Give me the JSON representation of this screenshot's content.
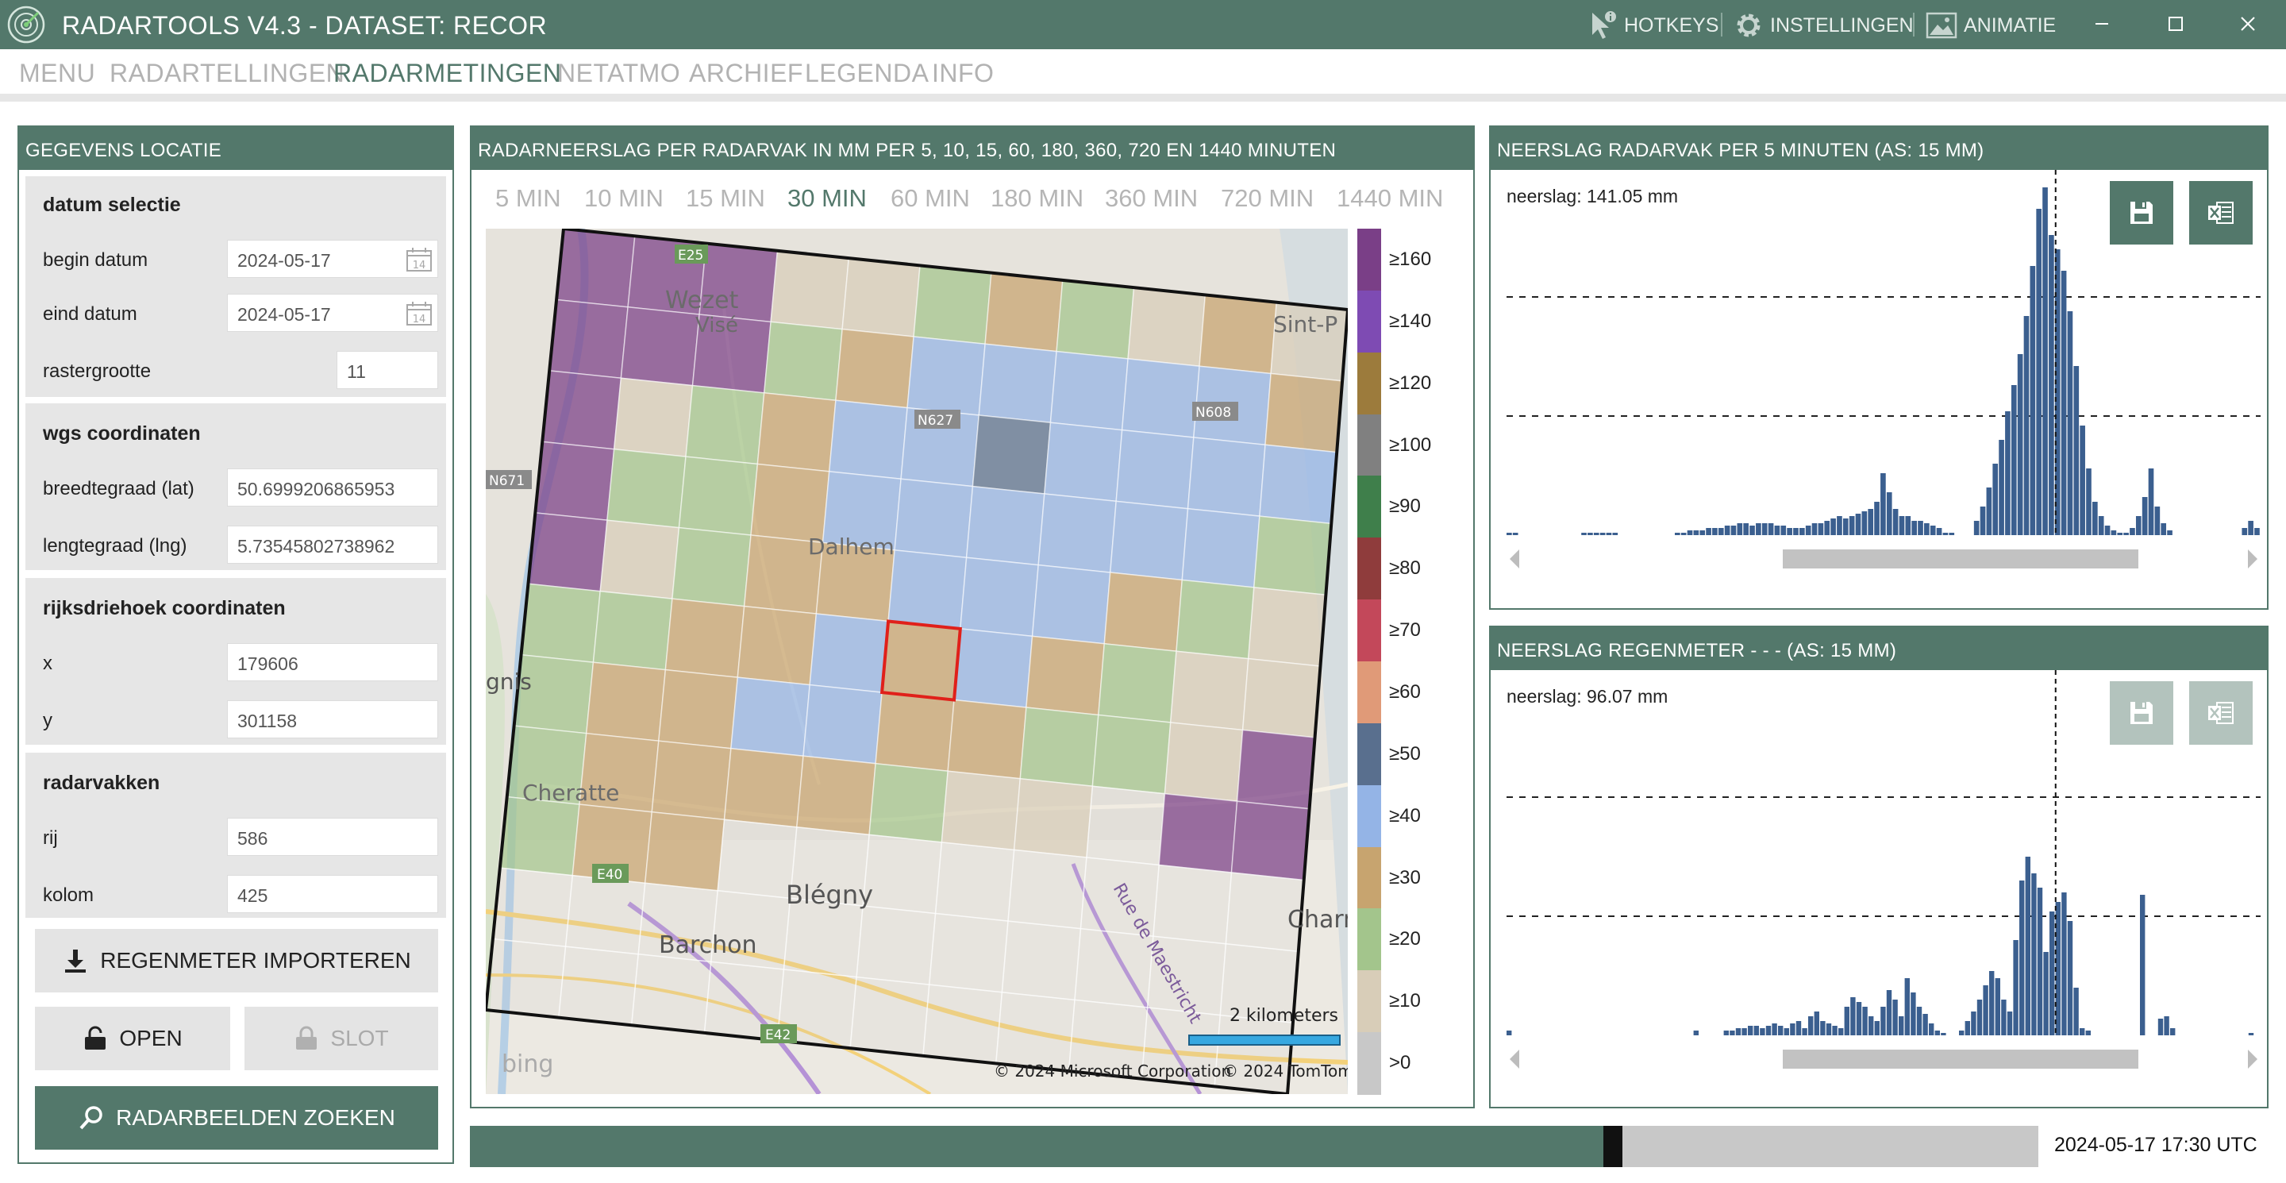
{
  "window": {
    "title": "RADARTOOLS V4.3 - DATASET: RECOR",
    "actions": {
      "hotkeys": "HOTKEYS",
      "settings": "INSTELLINGEN",
      "animation": "ANIMATIE"
    }
  },
  "menu": [
    "MENU",
    "RADARTELLINGEN",
    "RADARMETINGEN",
    "NETATMO",
    "ARCHIEF",
    "LEGENDA",
    "INFO"
  ],
  "menu_active": "RADARMETINGEN",
  "left_panel": {
    "title": "GEGEVENS LOCATIE",
    "date_selection": {
      "title": "datum selectie",
      "begin_label": "begin datum",
      "begin_value": "2024-05-17",
      "end_label": "eind datum",
      "end_value": "2024-05-17",
      "grid_label": "rastergrootte",
      "grid_value": "11"
    },
    "wgs": {
      "title": "wgs coordinaten",
      "lat_label": "breedtegraad (lat)",
      "lat_value": "50.6999206865953",
      "lng_label": "lengtegraad (lng)",
      "lng_value": "5.73545802738962"
    },
    "rd": {
      "title": "rijksdriehoek coordinaten",
      "x_label": "x",
      "x_value": "179606",
      "y_label": "y",
      "y_value": "301158"
    },
    "radar_cells": {
      "title": "radarvakken",
      "row_label": "rij",
      "row_value": "586",
      "col_label": "kolom",
      "col_value": "425"
    },
    "buttons": {
      "import": "REGENMETER IMPORTEREN",
      "open": "OPEN",
      "lock": "SLOT",
      "search": "RADARBEELDEN ZOEKEN"
    }
  },
  "map_panel": {
    "title": "RADARNEERSLAG PER RADARVAK IN MM PER 5, 10, 15, 60, 180, 360, 720 EN 1440 MINUTEN",
    "tabs": [
      "5 MIN",
      "10 MIN",
      "15 MIN",
      "30 MIN",
      "60 MIN",
      "180 MIN",
      "360 MIN",
      "720 MIN",
      "1440 MIN"
    ],
    "active_tab": "30 MIN",
    "map_labels": {
      "wezet": "Wezet",
      "vise": "Visé",
      "sint": "Sint-P",
      "dalhem": "Dalhem",
      "cheratte": "Cheratte",
      "blegny": "Blégny",
      "barchon": "Barchon",
      "charn": "Charn",
      "gnis": "gnis",
      "maestricht": "Rue de Maestricht",
      "n671": "N671",
      "e40": "E40",
      "e42": "E42",
      "n608": "N608",
      "n627": "N627",
      "e25": "E25"
    },
    "scale_label": "2 kilometers",
    "bing": "bing",
    "copyright_ms": "© 2024 Microsoft Corporation",
    "copyright_tt": "© 2024 TomTom",
    "legend": [
      {
        "label": "≥160",
        "color": "#7a3f87"
      },
      {
        "label": "≥140",
        "color": "#7e4bb3"
      },
      {
        "label": "≥120",
        "color": "#9c7b3c"
      },
      {
        "label": "≥100",
        "color": "#808080"
      },
      {
        "label": "≥90",
        "color": "#3f7f4b"
      },
      {
        "label": "≥80",
        "color": "#8f3c3c"
      },
      {
        "label": "≥70",
        "color": "#c3485a"
      },
      {
        "label": "≥60",
        "color": "#e09a78"
      },
      {
        "label": "≥50",
        "color": "#596f8e"
      },
      {
        "label": "≥40",
        "color": "#94b4e6"
      },
      {
        "label": "≥30",
        "color": "#c7a46f"
      },
      {
        "label": "≥20",
        "color": "#a3c58c"
      },
      {
        "label": "≥10",
        "color": "#d8cdb8"
      },
      {
        "label": ">0",
        "color": "#c8c8c8"
      }
    ],
    "grid": [
      [
        0,
        0,
        0,
        12,
        12,
        11,
        10,
        11,
        12,
        10,
        12
      ],
      [
        0,
        0,
        0,
        11,
        10,
        9,
        9,
        9,
        9,
        9,
        10
      ],
      [
        0,
        12,
        11,
        10,
        9,
        9,
        8,
        9,
        9,
        9,
        9
      ],
      [
        0,
        11,
        11,
        10,
        9,
        9,
        9,
        9,
        9,
        9,
        11
      ],
      [
        0,
        12,
        11,
        10,
        10,
        9,
        9,
        9,
        10,
        11,
        12
      ],
      [
        11,
        11,
        10,
        10,
        9,
        10,
        9,
        10,
        11,
        12,
        12
      ],
      [
        11,
        10,
        10,
        9,
        9,
        10,
        10,
        11,
        11,
        12,
        0
      ],
      [
        11,
        10,
        10,
        10,
        10,
        11,
        12,
        12,
        13,
        0,
        0
      ],
      [
        11,
        10,
        10,
        13,
        13,
        13,
        13,
        13,
        13,
        13,
        13
      ],
      [
        13,
        13,
        13,
        13,
        13,
        13,
        13,
        13,
        13,
        13,
        13
      ],
      [
        13,
        13,
        13,
        13,
        13,
        13,
        13,
        13,
        13,
        13,
        13
      ]
    ]
  },
  "chart1": {
    "title": "NEERSLAG RADARVAK PER 5 MINUTEN (AS: 15 MM)",
    "value_text": "neerslag: 141.05 mm",
    "values": [
      0.1,
      0.1,
      0,
      0,
      0,
      0,
      0,
      0,
      0,
      0,
      0,
      0,
      0.1,
      0.1,
      0.1,
      0.1,
      0.1,
      0.1,
      0,
      0,
      0,
      0,
      0,
      0,
      0,
      0,
      0,
      0.1,
      0.1,
      0.2,
      0.2,
      0.2,
      0.3,
      0.3,
      0.3,
      0.4,
      0.4,
      0.5,
      0.5,
      0.4,
      0.5,
      0.5,
      0.5,
      0.4,
      0.4,
      0.3,
      0.3,
      0.3,
      0.4,
      0.5,
      0.5,
      0.6,
      0.7,
      0.8,
      0.7,
      0.8,
      0.9,
      1.0,
      1.1,
      1.4,
      2.6,
      1.8,
      1.1,
      0.8,
      0.8,
      0.6,
      0.6,
      0.5,
      0.4,
      0.3,
      0.1,
      0.1,
      0,
      0,
      0,
      0.6,
      1.2,
      2.0,
      3.0,
      4.0,
      5.2,
      6.3,
      7.6,
      9.2,
      11.3,
      13.7,
      14.6,
      12.6,
      12.0,
      11.1,
      9.4,
      7.1,
      4.6,
      2.8,
      1.4,
      0.8,
      0.4,
      0.2,
      0.1,
      0.1,
      0.3,
      0.8,
      1.6,
      2.8,
      1.2,
      0.5,
      0.2,
      0,
      0,
      0,
      0,
      0,
      0,
      0,
      0,
      0,
      0,
      0,
      0.3,
      0.6,
      0.3
    ],
    "ymax": 15
  },
  "chart2": {
    "title": "NEERSLAG REGENMETER -  -  -  (AS: 15 MM)",
    "value_text": "neerslag: 96.07 mm",
    "values": [
      0.2,
      0,
      0,
      0,
      0,
      0,
      0,
      0,
      0,
      0,
      0,
      0,
      0,
      0,
      0,
      0,
      0,
      0,
      0,
      0,
      0,
      0,
      0,
      0,
      0,
      0,
      0,
      0,
      0,
      0,
      0,
      0.2,
      0,
      0,
      0,
      0,
      0.2,
      0.2,
      0.3,
      0.3,
      0.4,
      0.4,
      0.3,
      0.4,
      0.5,
      0.4,
      0.3,
      0.5,
      0.6,
      0.3,
      0.8,
      1.0,
      0.6,
      0.5,
      0.4,
      0.3,
      1.2,
      1.6,
      1.4,
      1.2,
      0.8,
      0.6,
      1.2,
      1.9,
      1.5,
      0.8,
      2.4,
      1.8,
      1.2,
      0.9,
      0.5,
      0.2,
      0.1,
      0,
      0,
      0.2,
      0.6,
      1.0,
      1.5,
      2.1,
      2.7,
      2.4,
      1.5,
      1.0,
      4.0,
      6.5,
      7.5,
      6.8,
      6.2,
      3.5,
      5.2,
      5.6,
      6.0,
      4.8,
      2.0,
      0.3,
      0.2,
      0,
      0,
      0,
      0,
      0,
      0,
      0,
      0,
      5.9,
      0,
      0,
      0.7,
      0.8,
      0.3,
      0,
      0,
      0,
      0,
      0,
      0,
      0,
      0,
      0,
      0,
      0,
      0,
      0.1,
      0
    ],
    "ymax": 15
  },
  "timeline": {
    "position": 0.74,
    "timestamp": "2024-05-17 17:30 UTC"
  }
}
